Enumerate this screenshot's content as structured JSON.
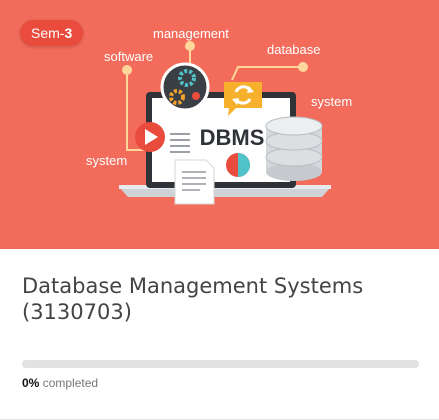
{
  "course": {
    "semester_prefix": "Sem-",
    "semester_number": "3",
    "title_line1": "Database Management Systems",
    "title_line2": "(3130703)",
    "progress_value": "0%",
    "progress_suffix": "completed",
    "progress_fraction": 0
  },
  "illustration": {
    "label_management": "management",
    "label_database": "database",
    "label_software": "software",
    "label_system_right": "system",
    "label_system_left": "system",
    "screen_text": "DBMS"
  },
  "colors": {
    "banner_bg": "#f26b5b",
    "badge_bg": "#e94b3c",
    "accent_orange": "#f7a32b",
    "screen_dark": "#2f3338"
  }
}
